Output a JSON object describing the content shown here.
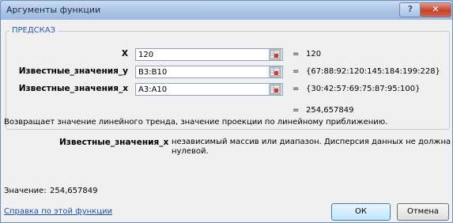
{
  "window": {
    "title": "Аргументы функции",
    "help_glyph": "?",
    "close_glyph": "✕"
  },
  "group": {
    "legend": "ПРЕДСКАЗ"
  },
  "args": [
    {
      "name": "X",
      "value": "120",
      "result": "120"
    },
    {
      "name": "Известные_значения_y",
      "value": "B3:B10",
      "result": "{67:88:92:120:145:184:199:228}"
    },
    {
      "name": "Известные_значения_x",
      "value": "A3:A10",
      "result": "{30:42:57:69:75:87:95:100}"
    }
  ],
  "equals_sign": "=",
  "formula_result": "254,657849",
  "description": "Возвращает значение линейного тренда, значение проекции по линейному приближению.",
  "arg_help": {
    "name": "Известные_значения_x",
    "line1": "независимый массив или диапазон. Дисперсия данных не должна быть",
    "line2": "нулевой."
  },
  "value_label": "Значение:",
  "value": "254,657849",
  "help_link": "Справка по этой функции",
  "buttons": {
    "ok": "ОК",
    "cancel": "Отмена"
  },
  "icons": {
    "ref": "range-select-icon"
  }
}
